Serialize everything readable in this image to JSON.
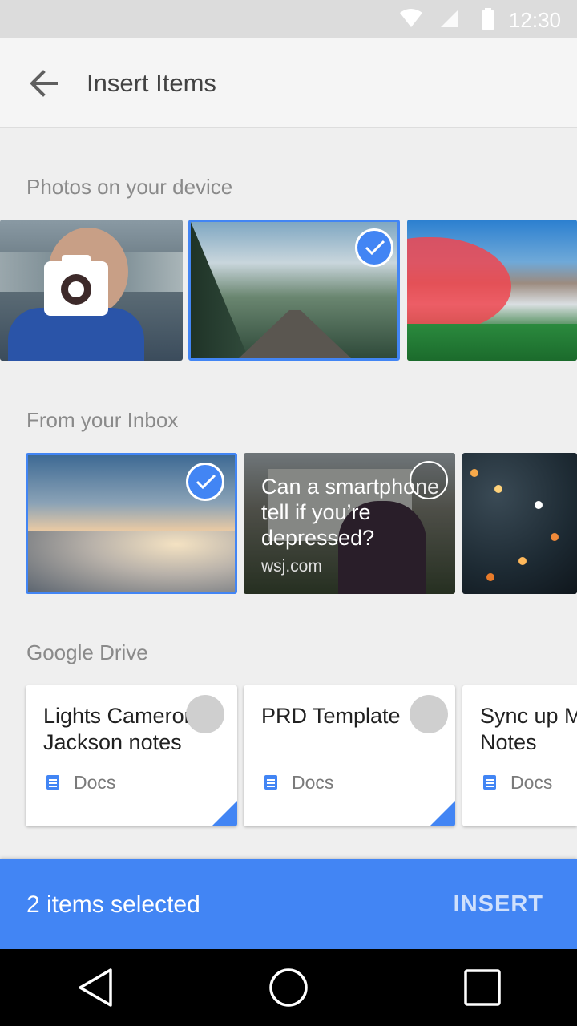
{
  "status_bar": {
    "time": "12:30",
    "icons": [
      "wifi-icon",
      "signal-icon",
      "battery-icon"
    ]
  },
  "app_bar": {
    "title": "Insert Items",
    "back_icon": "arrow-back-icon"
  },
  "sections": {
    "photos": {
      "title": "Photos on your device",
      "items": [
        {
          "name": "camera-photo",
          "selected": false,
          "icon": "camera-icon"
        },
        {
          "name": "railway-mountain-photo",
          "selected": true
        },
        {
          "name": "stadium-photo",
          "selected": false
        }
      ]
    },
    "inbox": {
      "title": "From your Inbox",
      "items": [
        {
          "name": "clouds-photo",
          "selected": true
        },
        {
          "name": "article-card",
          "selected": false,
          "text": "Can a smartphone tell if you’re depressed?",
          "source": "wsj.com"
        },
        {
          "name": "city-lights-photo",
          "selected": false
        }
      ]
    },
    "drive": {
      "title": "Google Drive",
      "items": [
        {
          "title_line1": "Lights Cameron",
          "title_line2": "Jackson notes",
          "type": "Docs"
        },
        {
          "title_line1": "PRD Template",
          "title_line2": "",
          "type": "Docs"
        },
        {
          "title_line1": "Sync up M",
          "title_line2": "Notes",
          "type": "Docs"
        }
      ]
    }
  },
  "bottom_bar": {
    "selection_text": "2 items selected",
    "action_label": "INSERT"
  },
  "colors": {
    "accent": "#4285f4",
    "background": "#efefef",
    "status_bar": "#dcdcdc"
  },
  "nav_bar": {
    "icons": [
      "back-triangle-icon",
      "home-circle-icon",
      "recents-square-icon"
    ]
  }
}
